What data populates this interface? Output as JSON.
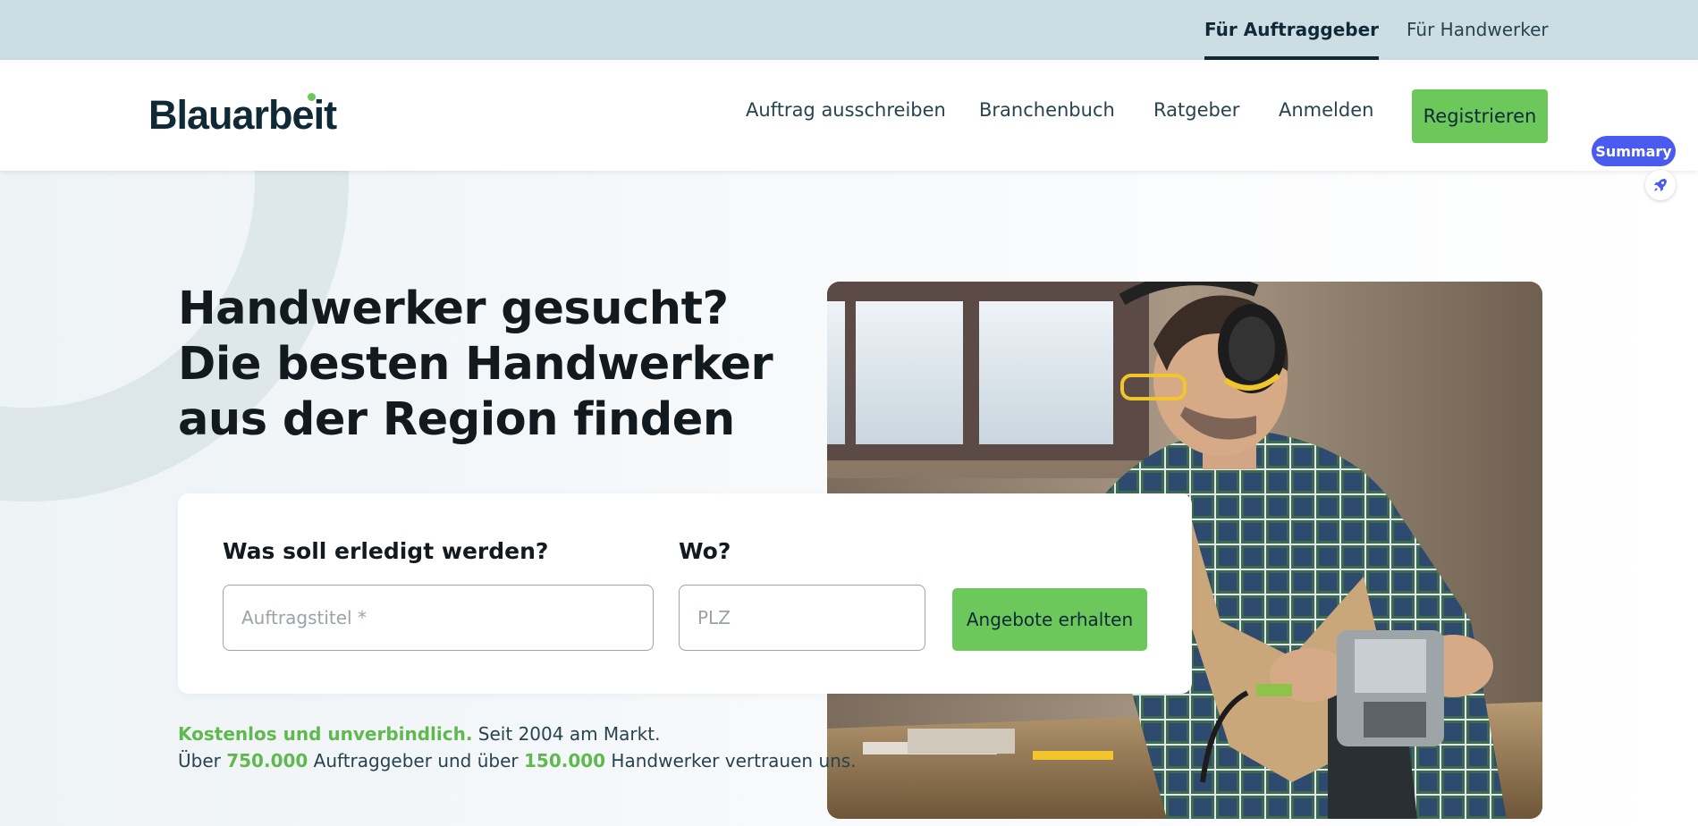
{
  "topbar": {
    "audiences": [
      {
        "label": "Für Auftraggeber",
        "active": true
      },
      {
        "label": "Für Handwerker",
        "active": false
      }
    ]
  },
  "header": {
    "logo": "Blauarbeit",
    "nav": [
      "Auftrag ausschreiben",
      "Branchenbuch",
      "Ratgeber",
      "Anmelden"
    ],
    "register_label": "Registrieren"
  },
  "widget": {
    "summary_label": "Summary",
    "icon": "rocket-icon"
  },
  "hero": {
    "headline": "Handwerker gesucht? Die besten Handwerker aus der Region finden",
    "image": "carpenter-with-router-photo"
  },
  "search": {
    "what_label": "Was soll erledigt werden?",
    "what_placeholder": "Auftragstitel *",
    "where_label": "Wo?",
    "where_placeholder": "PLZ",
    "submit_label": "Angebote erhalten"
  },
  "trust": {
    "line1_highlight": "Kostenlos und unverbindlich.",
    "line1_rest": " Seit 2004 am Markt.",
    "line2_pre": "Über ",
    "clients_count": "750.000",
    "line2_mid": " Auftraggeber und über ",
    "craftsmen_count": "150.000",
    "line2_post": " Handwerker vertrauen uns."
  },
  "colors": {
    "accent_green": "#6cc85a",
    "brand_navy": "#0f2a36",
    "topbar_bg": "#ccdde3",
    "widget_blue": "#4a5cf0"
  }
}
